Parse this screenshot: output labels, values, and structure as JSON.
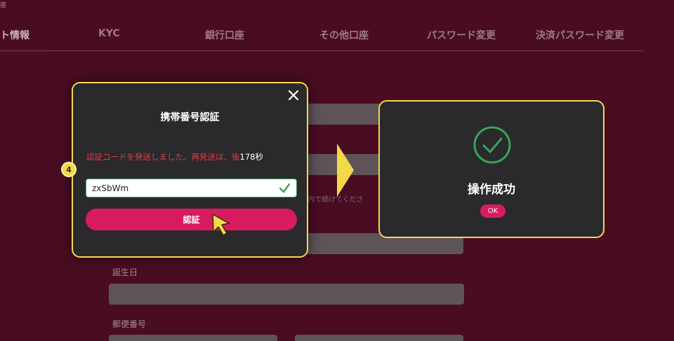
{
  "header": {
    "crumb": "座"
  },
  "tabs": [
    {
      "label": "ト情報"
    },
    {
      "label": "KYC"
    },
    {
      "label": "銀行口座"
    },
    {
      "label": "その他口座"
    },
    {
      "label": "パスワード変更"
    },
    {
      "label": "決済パスワード変更"
    }
  ],
  "form": {
    "birthday_label": "誕生日",
    "postal_label": "郵便番号",
    "hint_text": "内で続けてくださ"
  },
  "modal": {
    "title": "携帯番号認証",
    "sent_message": "認証コードを発送しました。再発送は、後",
    "countdown": "178秒",
    "code_value": "zxSbWm",
    "verify_label": "認証",
    "step_number": "4"
  },
  "success": {
    "message": "操作成功",
    "ok_label": "OK"
  },
  "colors": {
    "background": "#4a0c22",
    "dialog": "#2a2a2c",
    "highlight_border": "#f2d94a",
    "primary_button": "#d81b60",
    "error_text": "#e03848",
    "success_green": "#3aa35a"
  },
  "icons": {
    "close": "close-icon",
    "check": "check-icon",
    "pointer": "pointer-icon",
    "arrow": "arrow-right-icon",
    "success": "success-check-icon"
  }
}
